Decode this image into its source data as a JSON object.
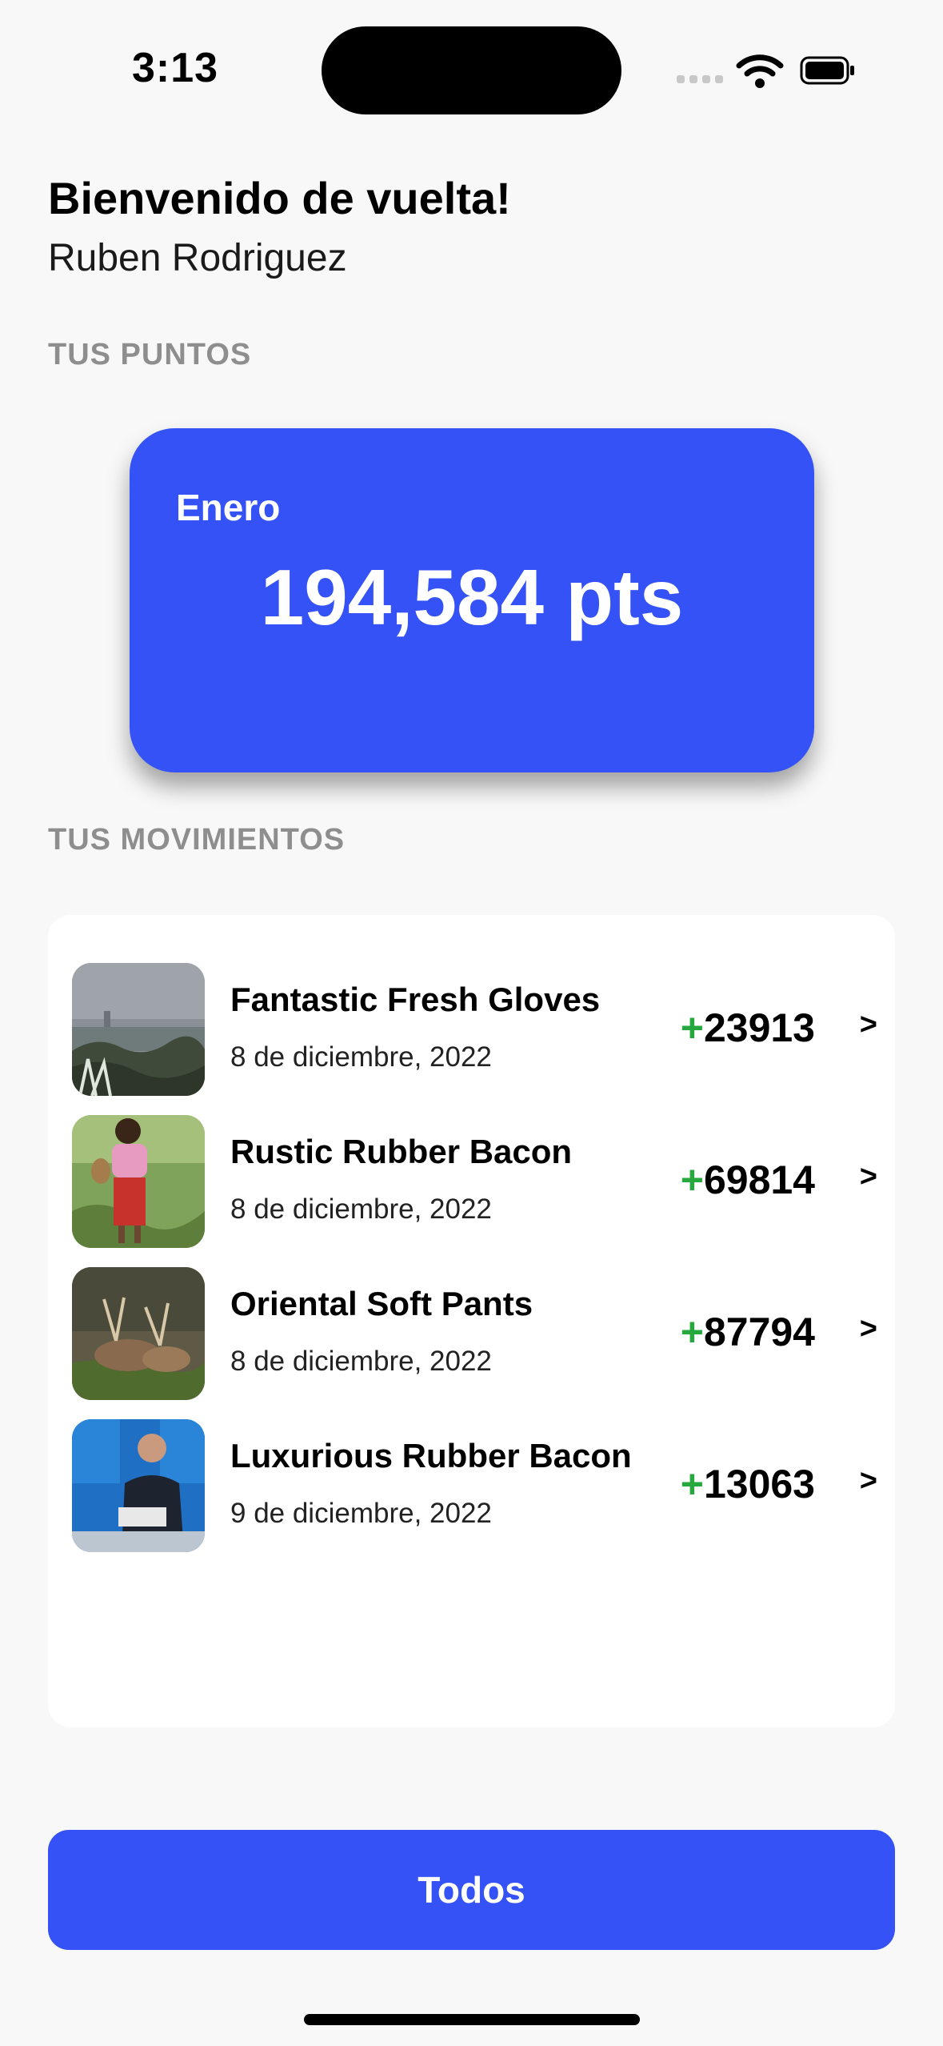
{
  "status_bar": {
    "time": "3:13",
    "icons": [
      "signal-dots-icon",
      "wifi-icon",
      "battery-icon"
    ]
  },
  "header": {
    "greeting": "Bienvenido de vuelta!",
    "user_name": "Ruben Rodriguez"
  },
  "points": {
    "section_label": "TUS PUNTOS",
    "month": "Enero",
    "value": "194,584 pts"
  },
  "movements": {
    "section_label": "TUS MOVIMIENTOS",
    "items": [
      {
        "title": "Fantastic Fresh Gloves",
        "date": "8 de diciembre, 2022",
        "sign": "+",
        "amount": "23913",
        "chevron": ">",
        "thumb": "city-landscape"
      },
      {
        "title": "Rustic Rubber Bacon",
        "date": "8 de diciembre, 2022",
        "sign": "+",
        "amount": "69814",
        "chevron": ">",
        "thumb": "woman-in-field"
      },
      {
        "title": "Oriental Soft Pants",
        "date": "8 de diciembre, 2022",
        "sign": "+",
        "amount": "87794",
        "chevron": ">",
        "thumb": "deer"
      },
      {
        "title": "Luxurious Rubber Bacon",
        "date": "9 de diciembre, 2022",
        "sign": "+",
        "amount": "13063",
        "chevron": ">",
        "thumb": "forum-speaker"
      }
    ]
  },
  "footer": {
    "all_button_label": "Todos"
  },
  "colors": {
    "accent": "#3452f5",
    "positive": "#27a83f",
    "section_label": "#8e8e8e",
    "background": "#f8f8f8"
  }
}
